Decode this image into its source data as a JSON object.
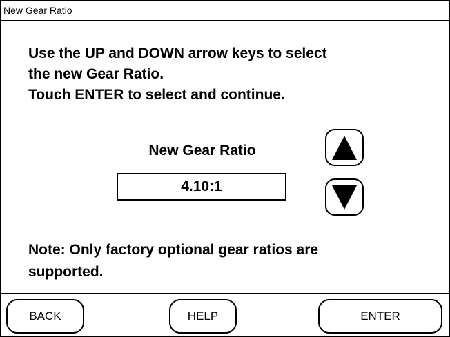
{
  "window": {
    "title": "New Gear Ratio"
  },
  "instructions": {
    "line1": "Use the UP and DOWN arrow keys to select",
    "line2": "the new Gear Ratio.",
    "line3": "Touch ENTER to select and continue."
  },
  "ratio": {
    "label": "New Gear Ratio",
    "value": "4.10:1"
  },
  "arrows": {
    "up_icon": "up-triangle",
    "down_icon": "down-triangle"
  },
  "note": {
    "line1": "Note: Only factory optional gear ratios are",
    "line2": "supported."
  },
  "buttons": {
    "back": "BACK",
    "help": "HELP",
    "enter": "ENTER"
  }
}
